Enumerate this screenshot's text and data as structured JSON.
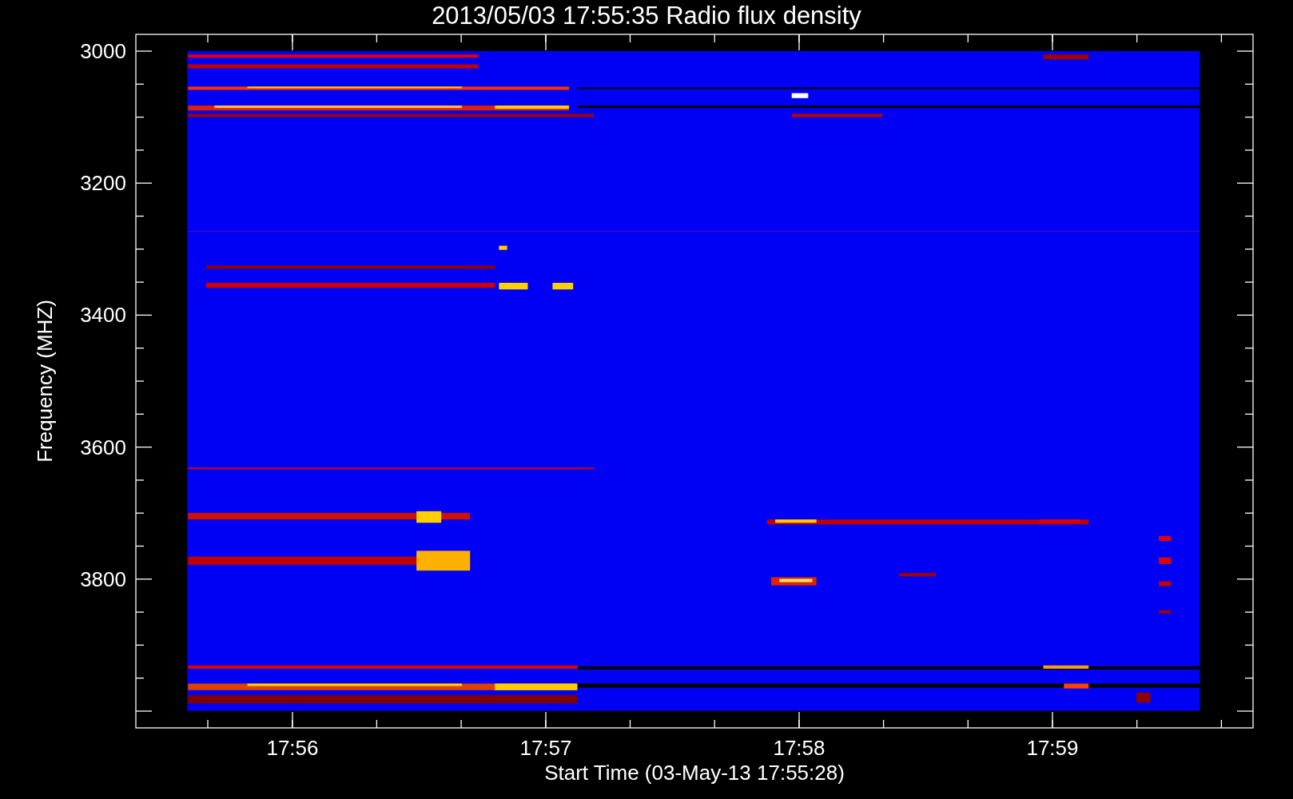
{
  "title": "2013/05/03 17:55:35 Radio flux density",
  "x_axis": {
    "label": "Start Time (03-May-13 17:55:28)",
    "ticks": [
      "17:56",
      "17:57",
      "17:58",
      "17:59"
    ]
  },
  "y_axis": {
    "label": "Frequency (MHZ)",
    "ticks": [
      "3000",
      "3200",
      "3400",
      "3600",
      "3800"
    ]
  }
}
